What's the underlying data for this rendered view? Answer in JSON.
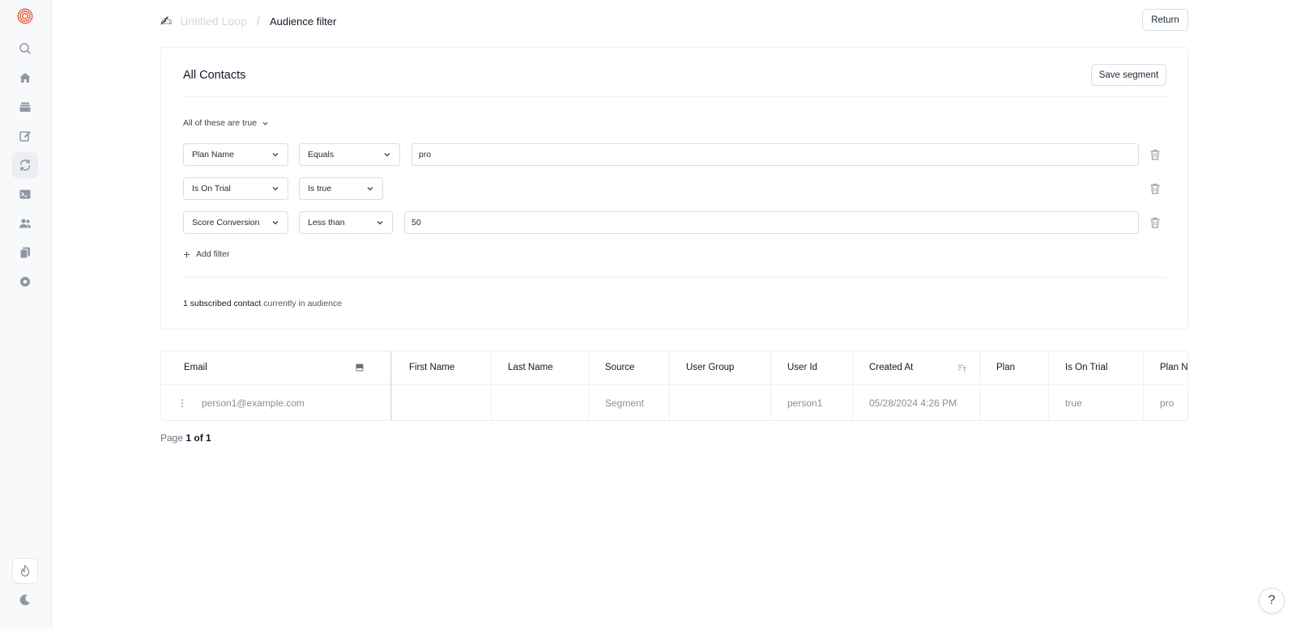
{
  "breadcrumb": {
    "icon": "✍",
    "parent": "Untitled Loop",
    "separator": "/",
    "current": "Audience filter"
  },
  "header": {
    "return_label": "Return"
  },
  "segment": {
    "title": "All Contacts",
    "save_label": "Save segment",
    "match_mode": "All of these are true",
    "filters": [
      {
        "field": "Plan Name",
        "operator": "Equals",
        "value": "pro"
      },
      {
        "field": "Is On Trial",
        "operator": "Is true",
        "value": null
      },
      {
        "field": "Score Conversion",
        "operator": "Less than",
        "value": "50"
      }
    ],
    "add_filter_label": "Add filter",
    "audience_count": "1 subscribed contact",
    "audience_suffix": "currently in audience"
  },
  "table": {
    "columns": [
      "Email",
      "First Name",
      "Last Name",
      "Source",
      "User Group",
      "User Id",
      "Created At",
      "Plan",
      "Is On Trial",
      "Plan N"
    ],
    "rows": [
      [
        "person1@example.com",
        "",
        "",
        "Segment",
        "",
        "person1",
        "05/28/2024 4:26 PM",
        "",
        "true",
        "pro"
      ]
    ]
  },
  "pagination": {
    "prefix": "Page",
    "value": "1 of 1"
  },
  "help_label": "?",
  "colors": {
    "brand": "#e8613c",
    "sidebar_icon": "#8f96a3"
  },
  "icons": {
    "sidebar": [
      "logo-icon",
      "search-icon",
      "home-icon",
      "inbox-icon",
      "edit-icon",
      "loop-icon",
      "terminal-icon",
      "users-icon",
      "files-icon",
      "settings-icon"
    ],
    "sidebar_bottom": [
      "flame-icon",
      "moon-icon"
    ]
  }
}
